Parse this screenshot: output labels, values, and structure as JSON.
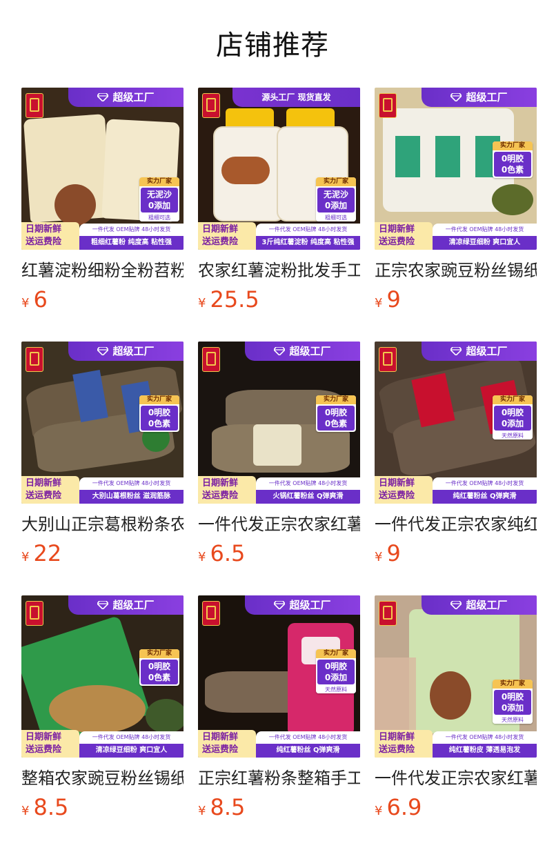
{
  "page": {
    "title": "店铺推荐"
  },
  "currency": "¥",
  "products": [
    {
      "title": "红薯淀粉细粉全粉苕粉",
      "price": "6",
      "banner": "超级工厂",
      "tag": {
        "head": "实力厂家",
        "lines": [
          "无泥沙",
          "0添加"
        ],
        "foot": "粗细可选"
      },
      "strip_left": [
        "日期新鲜",
        "送运费险"
      ],
      "strip_top": "一件代发 OEM贴牌 48小时发货",
      "strip_bottom": "粗细红薯粉 纯度高 粘性强",
      "colors": {
        "bg": "#3a2a1a",
        "product": "#efe3c0"
      }
    },
    {
      "title": "农家红薯淀粉批发手工",
      "price": "25.5",
      "banner": "源头工厂 现货直发",
      "tag": {
        "head": "实力厂家",
        "lines": [
          "无泥沙",
          "0添加"
        ],
        "foot": "粗细可选"
      },
      "strip_left": [
        "日期新鲜",
        "送运费险"
      ],
      "strip_top": "一件代发 OEM贴牌 48小时发货",
      "strip_bottom": "3斤纯红薯淀粉 纯度高 粘性强",
      "colors": {
        "bg": "#2a1a10",
        "product": "#f5f0e6"
      }
    },
    {
      "title": "正宗农家豌豆粉丝锡纸",
      "price": "9",
      "banner": "超级工厂",
      "tag": {
        "head": "实力厂家",
        "lines": [
          "0明胶",
          "0色素"
        ],
        "foot": ""
      },
      "strip_left": [
        "日期新鲜",
        "送运费险"
      ],
      "strip_top": "一件代发 OEM贴牌 48小时发货",
      "strip_bottom": "清凉绿豆细粉 爽口宜人",
      "colors": {
        "bg": "#d8c8a0",
        "product": "#f2efe6"
      }
    },
    {
      "title": "大别山正宗葛根粉条农家",
      "price": "22",
      "banner": "超级工厂",
      "tag": {
        "head": "实力厂家",
        "lines": [
          "0明胶",
          "0色素"
        ],
        "foot": ""
      },
      "strip_left": [
        "日期新鲜",
        "送运费险"
      ],
      "strip_top": "一件代发 OEM贴牌 48小时发货",
      "strip_bottom": "大别山葛根粉丝 滋润筋脉",
      "colors": {
        "bg": "#3d3222",
        "product": "#6b5a44"
      }
    },
    {
      "title": "一件代发正宗农家红薯",
      "price": "6.5",
      "banner": "超级工厂",
      "tag": {
        "head": "实力厂家",
        "lines": [
          "0明胶",
          "0色素"
        ],
        "foot": ""
      },
      "strip_left": [
        "日期新鲜",
        "送运费险"
      ],
      "strip_top": "一件代发 OEM贴牌 48小时发货",
      "strip_bottom": "火锅红薯粉丝 Q弹爽滑",
      "colors": {
        "bg": "#1a1410",
        "product": "#7a6a55"
      }
    },
    {
      "title": "一件代发正宗农家纯红",
      "price": "9",
      "banner": "超级工厂",
      "tag": {
        "head": "实力厂家",
        "lines": [
          "0明胶",
          "0添加"
        ],
        "foot": "天然原料"
      },
      "strip_left": [
        "日期新鲜",
        "送运费险"
      ],
      "strip_top": "一件代发 OEM贴牌 48小时发货",
      "strip_bottom": "纯红薯粉丝 Q弹爽滑",
      "colors": {
        "bg": "#4a3a2e",
        "product": "#5b4a3c"
      }
    },
    {
      "title": "整箱农家豌豆粉丝锡纸",
      "price": "8.5",
      "banner": "超级工厂",
      "tag": {
        "head": "实力厂家",
        "lines": [
          "0明胶",
          "0色素"
        ],
        "foot": ""
      },
      "strip_left": [
        "日期新鲜",
        "送运费险"
      ],
      "strip_top": "一件代发 OEM贴牌 48小时发货",
      "strip_bottom": "清凉绿豆细粉 爽口宜人",
      "colors": {
        "bg": "#2e2418",
        "product": "#2f9a4a"
      }
    },
    {
      "title": "正宗红薯粉条整箱手工",
      "price": "8.5",
      "banner": "超级工厂",
      "tag": {
        "head": "实力厂家",
        "lines": [
          "0明胶",
          "0添加"
        ],
        "foot": "天然原料"
      },
      "strip_left": [
        "日期新鲜",
        "送运费险"
      ],
      "strip_top": "一件代发 OEM贴牌 48小时发货",
      "strip_bottom": "纯红薯粉丝 Q弹爽滑",
      "colors": {
        "bg": "#1a120c",
        "product": "#d6286a"
      }
    },
    {
      "title": "一件代发正宗农家红薯",
      "price": "6.9",
      "banner": "超级工厂",
      "tag": {
        "head": "实力厂家",
        "lines": [
          "0明胶",
          "0添加"
        ],
        "foot": "天然原料"
      },
      "strip_left": [
        "日期新鲜",
        "送运费险"
      ],
      "strip_top": "一件代发 OEM贴牌 48小时发货",
      "strip_bottom": "纯红薯粉皮 薄透易泡发",
      "colors": {
        "bg": "#c0a890",
        "product": "#cfe3b0"
      }
    }
  ]
}
